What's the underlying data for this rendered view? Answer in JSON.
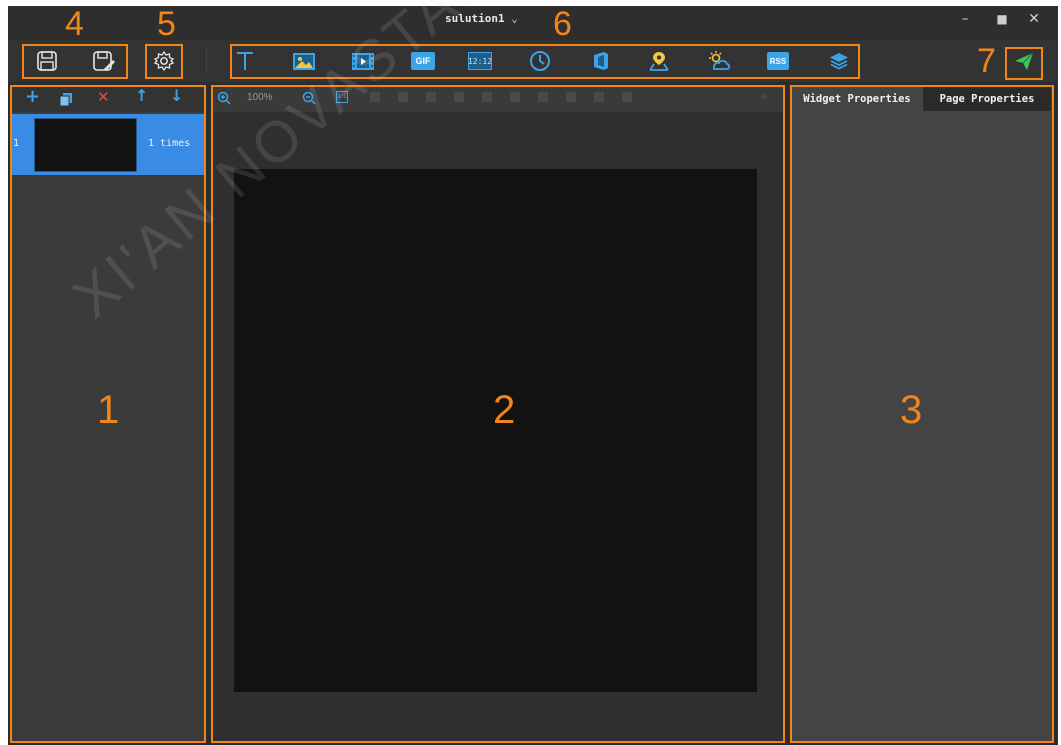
{
  "window": {
    "title": "sulution1",
    "minimize_icon": "minimize-icon",
    "maximize_icon": "maximize-icon",
    "close_icon": "close-icon"
  },
  "callouts": [
    "1",
    "2",
    "3",
    "4",
    "5",
    "6",
    "7"
  ],
  "toolbar": {
    "file_buttons": [
      {
        "name": "save",
        "icon": "save-icon"
      },
      {
        "name": "save-as",
        "icon": "save-as-icon"
      }
    ],
    "settings_icon": "gear-icon",
    "media_buttons": [
      {
        "name": "text",
        "icon": "text-icon"
      },
      {
        "name": "image",
        "icon": "image-icon"
      },
      {
        "name": "video",
        "icon": "video-icon"
      },
      {
        "name": "gif",
        "icon": "gif-icon",
        "label": "GIF"
      },
      {
        "name": "digital-clock",
        "icon": "digital-clock-icon",
        "label": "12:12"
      },
      {
        "name": "analog-clock",
        "icon": "analog-clock-icon"
      },
      {
        "name": "office",
        "icon": "office-icon"
      },
      {
        "name": "map",
        "icon": "map-pin-icon"
      },
      {
        "name": "weather",
        "icon": "weather-icon"
      },
      {
        "name": "rss",
        "icon": "rss-icon",
        "label": "RSS"
      },
      {
        "name": "layers",
        "icon": "layers-icon"
      }
    ],
    "publish_icon": "send-icon",
    "accent": "#f0851c"
  },
  "page_list": {
    "toolbar": [
      "add-icon",
      "copy-icon",
      "delete-icon",
      "up-arrow-icon",
      "down-arrow-icon"
    ],
    "items": [
      {
        "index": "1",
        "times": "1 times"
      }
    ],
    "selected_color": "#3a8be3"
  },
  "canvas": {
    "zoom": "100%"
  },
  "properties": {
    "tabs": [
      "Widget Properties",
      "Page Properties"
    ]
  },
  "watermark": "XI'AN NOVASTAR"
}
